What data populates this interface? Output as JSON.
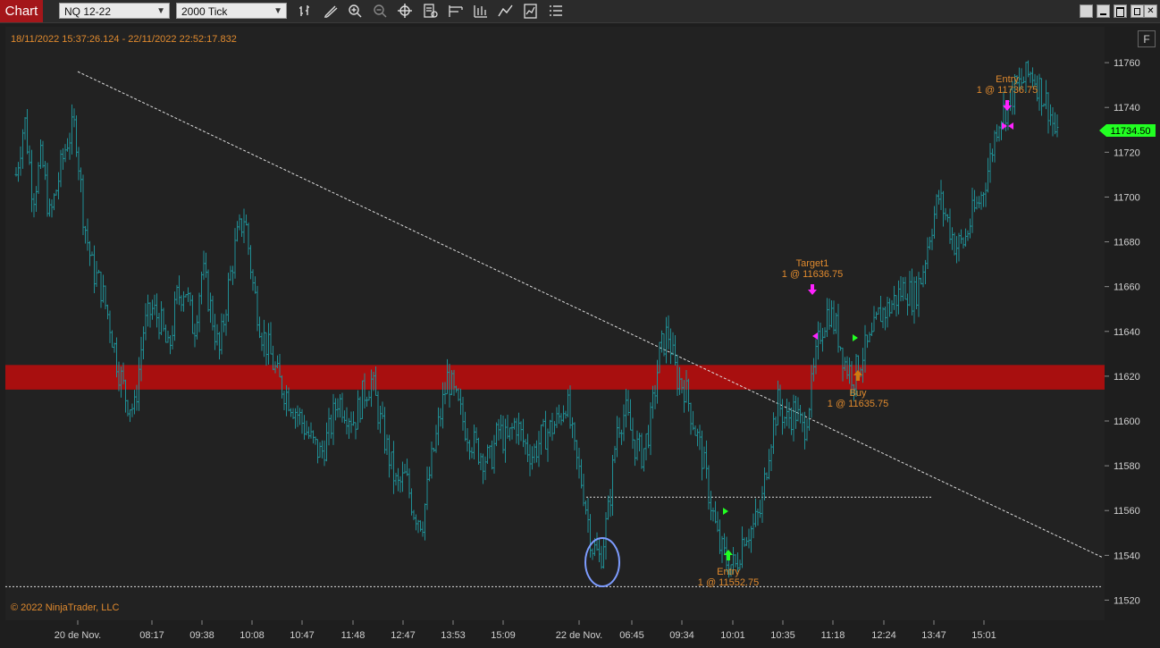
{
  "toolbar": {
    "chart_tab": "Chart",
    "instrument": "NQ 12-22",
    "interval": "2000 Tick",
    "icons": [
      "bar-type-icon",
      "draw-pencil-icon",
      "zoom-in-icon",
      "zoom-out-icon",
      "crosshair-icon",
      "properties-icon",
      "templates-icon",
      "data-box-icon",
      "indicators-icon",
      "strategies-icon",
      "list-icon"
    ]
  },
  "header": {
    "date_range": "18/11/2022 15:37:26.124 - 22/11/2022 22:52:17.832",
    "f_button": "F",
    "copyright": "© 2022 NinjaTrader, LLC"
  },
  "colors": {
    "background": "#222222",
    "bars": "#1f8f95",
    "zone": "#a80f0f",
    "accent_text": "#e08a2e",
    "price_marker": "#22ff22",
    "exit_marker": "#ff22ff",
    "circle": "#7d9cff"
  },
  "chart_data": {
    "type": "bar",
    "instrument": "NQ 12-22",
    "ylim": [
      11511,
      11776
    ],
    "y_ticks": [
      11520,
      11540,
      11560,
      11580,
      11600,
      11620,
      11640,
      11660,
      11680,
      11700,
      11720,
      11740,
      11760
    ],
    "x_ticks": [
      "20 de Nov.",
      "08:17",
      "09:38",
      "10:08",
      "10:47",
      "11:48",
      "12:47",
      "13:53",
      "15:09",
      "22 de Nov.",
      "06:45",
      "09:34",
      "10:01",
      "10:35",
      "11:18",
      "12:24",
      "13:47",
      "15:01"
    ],
    "current_price": "11734.50",
    "support_zone": [
      11614,
      11625
    ],
    "horizontal_lines": [
      11526,
      11566
    ],
    "trendline": {
      "from_price": 11756,
      "to_price": 11539
    },
    "price_path": [
      11710,
      11735,
      11700,
      11718,
      11690,
      11708,
      11725,
      11732,
      11690,
      11668,
      11660,
      11645,
      11625,
      11610,
      11605,
      11640,
      11650,
      11645,
      11630,
      11655,
      11660,
      11640,
      11668,
      11650,
      11630,
      11658,
      11680,
      11692,
      11660,
      11640,
      11630,
      11618,
      11612,
      11605,
      11598,
      11590,
      11585,
      11595,
      11610,
      11605,
      11600,
      11612,
      11618,
      11600,
      11585,
      11570,
      11575,
      11560,
      11555,
      11580,
      11600,
      11620,
      11608,
      11598,
      11590,
      11585,
      11582,
      11596,
      11590,
      11600,
      11590,
      11585,
      11592,
      11596,
      11600,
      11610,
      11585,
      11570,
      11545,
      11538,
      11560,
      11598,
      11604,
      11590,
      11585,
      11600,
      11630,
      11640,
      11620,
      11615,
      11600,
      11585,
      11565,
      11545,
      11537,
      11535,
      11550,
      11552,
      11560,
      11590,
      11608,
      11600,
      11605,
      11595,
      11615,
      11640,
      11650,
      11640,
      11625,
      11620,
      11630,
      11635,
      11648,
      11650,
      11655,
      11660,
      11655,
      11665,
      11685,
      11700,
      11690,
      11678,
      11680,
      11692,
      11700,
      11715,
      11735,
      11740,
      11748,
      11752,
      11756,
      11748,
      11740,
      11725
    ],
    "annotations": [
      {
        "name": "entry-short",
        "title": "Entry",
        "detail": "1 @ 11736.75",
        "price": 11736.75
      },
      {
        "name": "target1",
        "title": "Target1",
        "detail": "1 @ 11636.75",
        "price": 11636.75
      },
      {
        "name": "buy",
        "title": "Buy",
        "detail": "1 @ 11635.75",
        "price": 11635.75
      },
      {
        "name": "entry-long",
        "title": "Entry",
        "detail": "1 @ 11552.75",
        "price": 11552.75
      }
    ]
  }
}
